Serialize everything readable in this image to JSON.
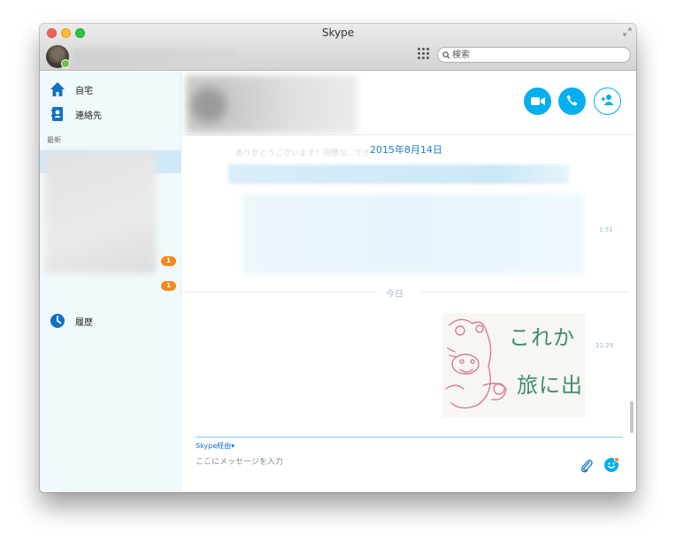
{
  "window": {
    "title": "Skype"
  },
  "search": {
    "placeholder": "検索"
  },
  "sidebar": {
    "home_label": "自宅",
    "contacts_label": "連絡先",
    "recent_section": "最新",
    "history_label": "履歴",
    "badges": [
      "1",
      "1"
    ]
  },
  "chat": {
    "date_label": "2015年8月14日",
    "ghost_message": "ありがとうございます！同僚な…できました！",
    "time_1": "1:51",
    "today_label": "今日",
    "time_2": "21:29",
    "image_text_line1": "これか",
    "image_text_line2": "旅に出"
  },
  "composer": {
    "via_label": "Skype経由",
    "via_caret": "▾",
    "placeholder": "ここにメッセージを入力"
  },
  "colors": {
    "accent": "#00aff0",
    "badge": "#f28b20",
    "link": "#1a7fc8"
  },
  "icons": [
    "fullscreen-icon",
    "dialpad-icon",
    "search-icon",
    "home-icon",
    "contacts-icon",
    "history-icon",
    "video-call-icon",
    "call-icon",
    "add-person-icon",
    "attach-icon",
    "emoji-icon"
  ]
}
